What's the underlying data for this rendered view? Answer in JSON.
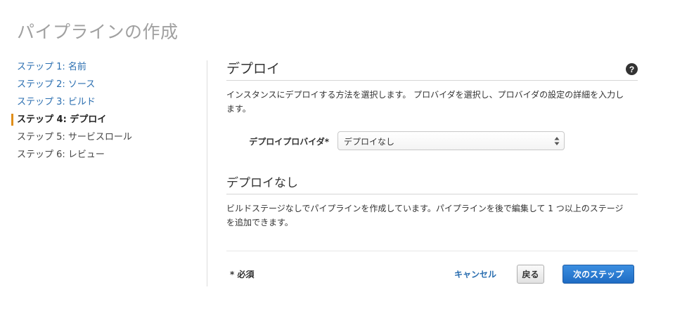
{
  "page": {
    "title": "パイプラインの作成"
  },
  "sidebar": {
    "steps": [
      {
        "label": "ステップ 1: 名前",
        "state": "link"
      },
      {
        "label": "ステップ 2: ソース",
        "state": "link"
      },
      {
        "label": "ステップ 3: ビルド",
        "state": "link"
      },
      {
        "label": "ステップ 4: デプロイ",
        "state": "active"
      },
      {
        "label": "ステップ 5: サービスロール",
        "state": "pending"
      },
      {
        "label": "ステップ 6: レビュー",
        "state": "pending"
      }
    ],
    "active_indicator_color": "#e08e1a"
  },
  "deploy_section": {
    "title": "デプロイ",
    "help_icon": "question-circle-icon",
    "description": "インスタンスにデプロイする方法を選択します。 プロバイダを選択し、プロバイダの設定の詳細を入力します。",
    "provider_label": "デプロイプロバイダ*",
    "provider_value": "デプロイなし"
  },
  "no_deploy_section": {
    "title": "デプロイなし",
    "description": "ビルドステージなしでパイプラインを作成しています。パイプラインを後で編集して 1 つ以上のステージを追加できます。"
  },
  "footer": {
    "required_note": "* 必須",
    "cancel_label": "キャンセル",
    "back_label": "戻る",
    "next_label": "次のステップ"
  },
  "colors": {
    "link": "#2a6eb0",
    "primary_button": "#1f6cc4"
  }
}
